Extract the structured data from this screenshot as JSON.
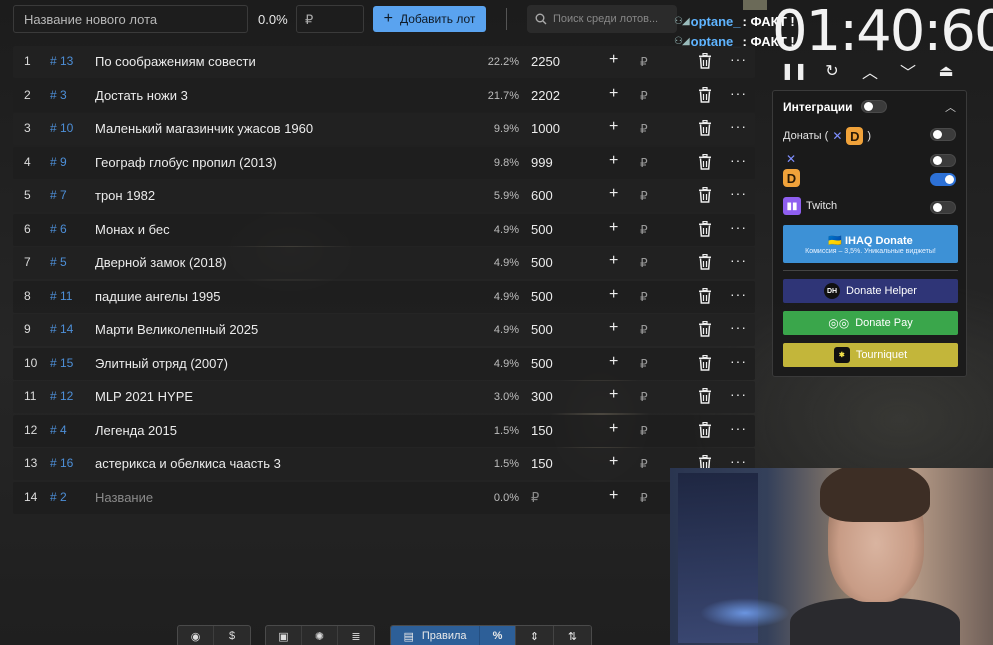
{
  "top_bar": {
    "lot_name_placeholder": "Название нового лота",
    "percent": "0.0%",
    "amount_placeholder": "₽",
    "add_lot_label": "Добавить лот",
    "search_placeholder": "Поиск среди лотов..."
  },
  "chat": [
    {
      "user": "optane_",
      "message": ": ФАКТ !"
    },
    {
      "user": "optane_",
      "message": ": ФАКТ !"
    }
  ],
  "timer": {
    "value": "01:40:60"
  },
  "lots": [
    {
      "index": "1",
      "id": "# 13",
      "name": "По соображениям совести",
      "percent": "22.2%",
      "amount": "2250"
    },
    {
      "index": "2",
      "id": "# 3",
      "name": "Достать ножи 3",
      "percent": "21.7%",
      "amount": "2202"
    },
    {
      "index": "3",
      "id": "# 10",
      "name": "Маленький магазинчик ужасов 1960",
      "percent": "9.9%",
      "amount": "1000"
    },
    {
      "index": "4",
      "id": "# 9",
      "name": "Географ глобус пропил (2013)",
      "percent": "9.8%",
      "amount": "999"
    },
    {
      "index": "5",
      "id": "# 7",
      "name": "трон 1982",
      "percent": "5.9%",
      "amount": "600"
    },
    {
      "index": "6",
      "id": "# 6",
      "name": "Монах и бес",
      "percent": "4.9%",
      "amount": "500"
    },
    {
      "index": "7",
      "id": "# 5",
      "name": "Дверной замок (2018)",
      "percent": "4.9%",
      "amount": "500"
    },
    {
      "index": "8",
      "id": "# 11",
      "name": "падшие ангелы 1995",
      "percent": "4.9%",
      "amount": "500"
    },
    {
      "index": "9",
      "id": "# 14",
      "name": "Марти Великолепный 2025",
      "percent": "4.9%",
      "amount": "500"
    },
    {
      "index": "10",
      "id": "# 15",
      "name": "Элитный отряд (2007)",
      "percent": "4.9%",
      "amount": "500"
    },
    {
      "index": "11",
      "id": "# 12",
      "name": "MLP 2021 HYPE",
      "percent": "3.0%",
      "amount": "300"
    },
    {
      "index": "12",
      "id": "# 4",
      "name": "Легенда 2015",
      "percent": "1.5%",
      "amount": "150"
    },
    {
      "index": "13",
      "id": "# 16",
      "name": "астерикса и обелкиса чаасть 3",
      "percent": "1.5%",
      "amount": "150"
    }
  ],
  "empty_lot": {
    "index": "14",
    "id": "# 2",
    "name_placeholder": "Название",
    "percent": "0.0%",
    "amount_placeholder": "₽"
  },
  "row_currency": "₽",
  "integrations": {
    "title": "Интеграции",
    "donations_label": "Донаты (",
    "donations_close": ")",
    "twitch_label": "Twitch",
    "ihaq_label": "IHAQ Donate",
    "ihaq_sub": "Комиссия – 3,5%. Уникальные виджеты!",
    "donate_helper_label": "Donate Helper",
    "donate_pay_label": "Donate Pay",
    "tourniquet_label": "Tourniquet",
    "toggles": {
      "main": false,
      "donations": false,
      "x": false,
      "d": true,
      "twitch": false
    }
  },
  "bottom_toolbar": {
    "rules_label": "Правила",
    "percent_label": "%"
  },
  "colors": {
    "accent": "#5aa3ef",
    "id_link": "#4d8fd8",
    "ihaq": "#3d91d6",
    "donate_helper": "#2f3577",
    "donate_pay": "#3aa64b",
    "tourniquet": "#c3b63a"
  }
}
